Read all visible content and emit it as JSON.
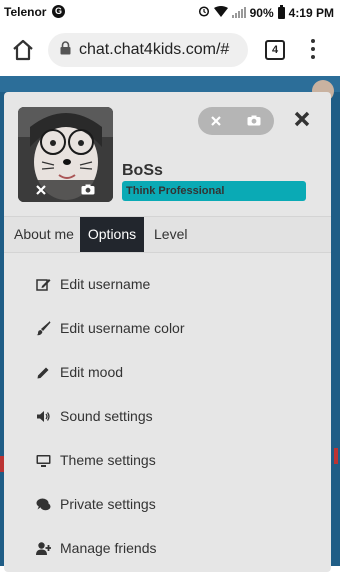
{
  "status_bar": {
    "carrier": "Telenor",
    "battery_percent": "90%",
    "time": "4:19 PM"
  },
  "browser": {
    "url": "chat.chat4kids.com/#",
    "tab_count": "4"
  },
  "profile": {
    "username": "BoSs",
    "mood": "Think Professional",
    "colors": {
      "mood_bar": "#0aaab5",
      "active_tab": "#22262d"
    }
  },
  "tabs": [
    {
      "label": "About me",
      "active": false
    },
    {
      "label": "Options",
      "active": true
    },
    {
      "label": "Level",
      "active": false
    }
  ],
  "options": [
    {
      "label": "Edit username",
      "icon": "edit-icon"
    },
    {
      "label": "Edit username color",
      "icon": "brush-icon"
    },
    {
      "label": "Edit mood",
      "icon": "pencil-icon"
    },
    {
      "label": "Sound settings",
      "icon": "volume-icon"
    },
    {
      "label": "Theme settings",
      "icon": "monitor-icon"
    },
    {
      "label": "Private settings",
      "icon": "chat-icon"
    },
    {
      "label": "Manage friends",
      "icon": "add-user-icon"
    }
  ]
}
